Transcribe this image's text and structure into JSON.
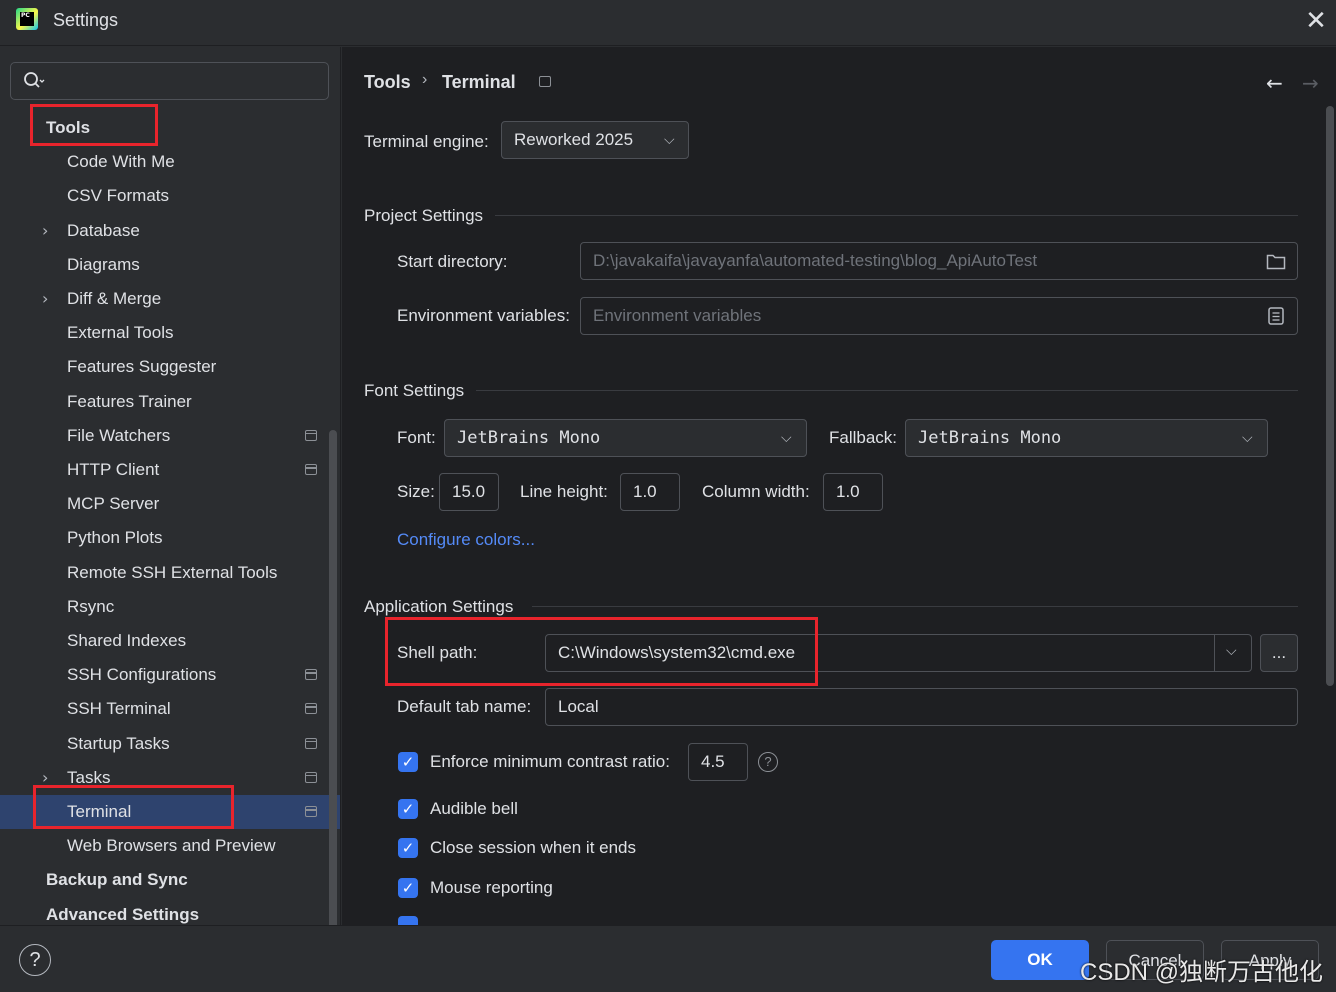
{
  "window": {
    "title": "Settings"
  },
  "search": {
    "placeholder": ""
  },
  "sidebar": {
    "items": [
      {
        "label": "Tools",
        "level": 0,
        "expandable": false,
        "project": false
      },
      {
        "label": "Code With Me",
        "level": 1,
        "expandable": false,
        "project": false
      },
      {
        "label": "CSV Formats",
        "level": 1,
        "expandable": false,
        "project": false
      },
      {
        "label": "Database",
        "level": 1,
        "expandable": true,
        "project": false
      },
      {
        "label": "Diagrams",
        "level": 1,
        "expandable": false,
        "project": false
      },
      {
        "label": "Diff & Merge",
        "level": 1,
        "expandable": true,
        "project": false
      },
      {
        "label": "External Tools",
        "level": 1,
        "expandable": false,
        "project": false
      },
      {
        "label": "Features Suggester",
        "level": 1,
        "expandable": false,
        "project": false
      },
      {
        "label": "Features Trainer",
        "level": 1,
        "expandable": false,
        "project": false
      },
      {
        "label": "File Watchers",
        "level": 1,
        "expandable": false,
        "project": true
      },
      {
        "label": "HTTP Client",
        "level": 1,
        "expandable": false,
        "project": true
      },
      {
        "label": "MCP Server",
        "level": 1,
        "expandable": false,
        "project": false
      },
      {
        "label": "Python Plots",
        "level": 1,
        "expandable": false,
        "project": false
      },
      {
        "label": "Remote SSH External Tools",
        "level": 1,
        "expandable": false,
        "project": false
      },
      {
        "label": "Rsync",
        "level": 1,
        "expandable": false,
        "project": false
      },
      {
        "label": "Shared Indexes",
        "level": 1,
        "expandable": false,
        "project": false
      },
      {
        "label": "SSH Configurations",
        "level": 1,
        "expandable": false,
        "project": true
      },
      {
        "label": "SSH Terminal",
        "level": 1,
        "expandable": false,
        "project": true
      },
      {
        "label": "Startup Tasks",
        "level": 1,
        "expandable": false,
        "project": true
      },
      {
        "label": "Tasks",
        "level": 1,
        "expandable": true,
        "project": true
      },
      {
        "label": "Terminal",
        "level": 1,
        "expandable": false,
        "project": true,
        "selected": true
      },
      {
        "label": "Web Browsers and Preview",
        "level": 1,
        "expandable": false,
        "project": false
      },
      {
        "label": "Backup and Sync",
        "level": 0,
        "expandable": false,
        "project": false
      },
      {
        "label": "Advanced Settings",
        "level": 0,
        "expandable": false,
        "project": false
      }
    ]
  },
  "breadcrumb": {
    "parent": "Tools",
    "separator": "›",
    "current": "Terminal"
  },
  "engine": {
    "label": "Terminal engine:",
    "value": "Reworked 2025"
  },
  "project_settings": {
    "title": "Project Settings",
    "start_directory_label": "Start directory:",
    "start_directory_value": "D:\\javakaifa\\javayanfa\\automated-testing\\blog_ApiAutoTest",
    "env_label": "Environment variables:",
    "env_placeholder": "Environment variables"
  },
  "font_settings": {
    "title": "Font Settings",
    "font_label": "Font:",
    "font_value": "JetBrains Mono",
    "fallback_label": "Fallback:",
    "fallback_value": "JetBrains Mono",
    "size_label": "Size:",
    "size_value": "15.0",
    "line_height_label": "Line height:",
    "line_height_value": "1.0",
    "column_width_label": "Column width:",
    "column_width_value": "1.0",
    "configure_colors": "Configure colors..."
  },
  "app_settings": {
    "title": "Application Settings",
    "shell_path_label": "Shell path:",
    "shell_path_value": "C:\\Windows\\system32\\cmd.exe",
    "browse_label": "...",
    "default_tab_label": "Default tab name:",
    "default_tab_value": "Local",
    "contrast_label": "Enforce minimum contrast ratio:",
    "contrast_value": "4.5",
    "help_glyph": "?",
    "audible_bell": "Audible bell",
    "close_session": "Close session when it ends",
    "mouse_reporting": "Mouse reporting"
  },
  "footer": {
    "help": "?",
    "ok": "OK",
    "cancel": "Cancel",
    "apply": "Apply"
  },
  "watermark": "CSDN @独断万古他化",
  "colors": {
    "accent": "#3574f0",
    "highlight": "#e8242c",
    "selected_row": "#2e436e",
    "link": "#548af7"
  }
}
